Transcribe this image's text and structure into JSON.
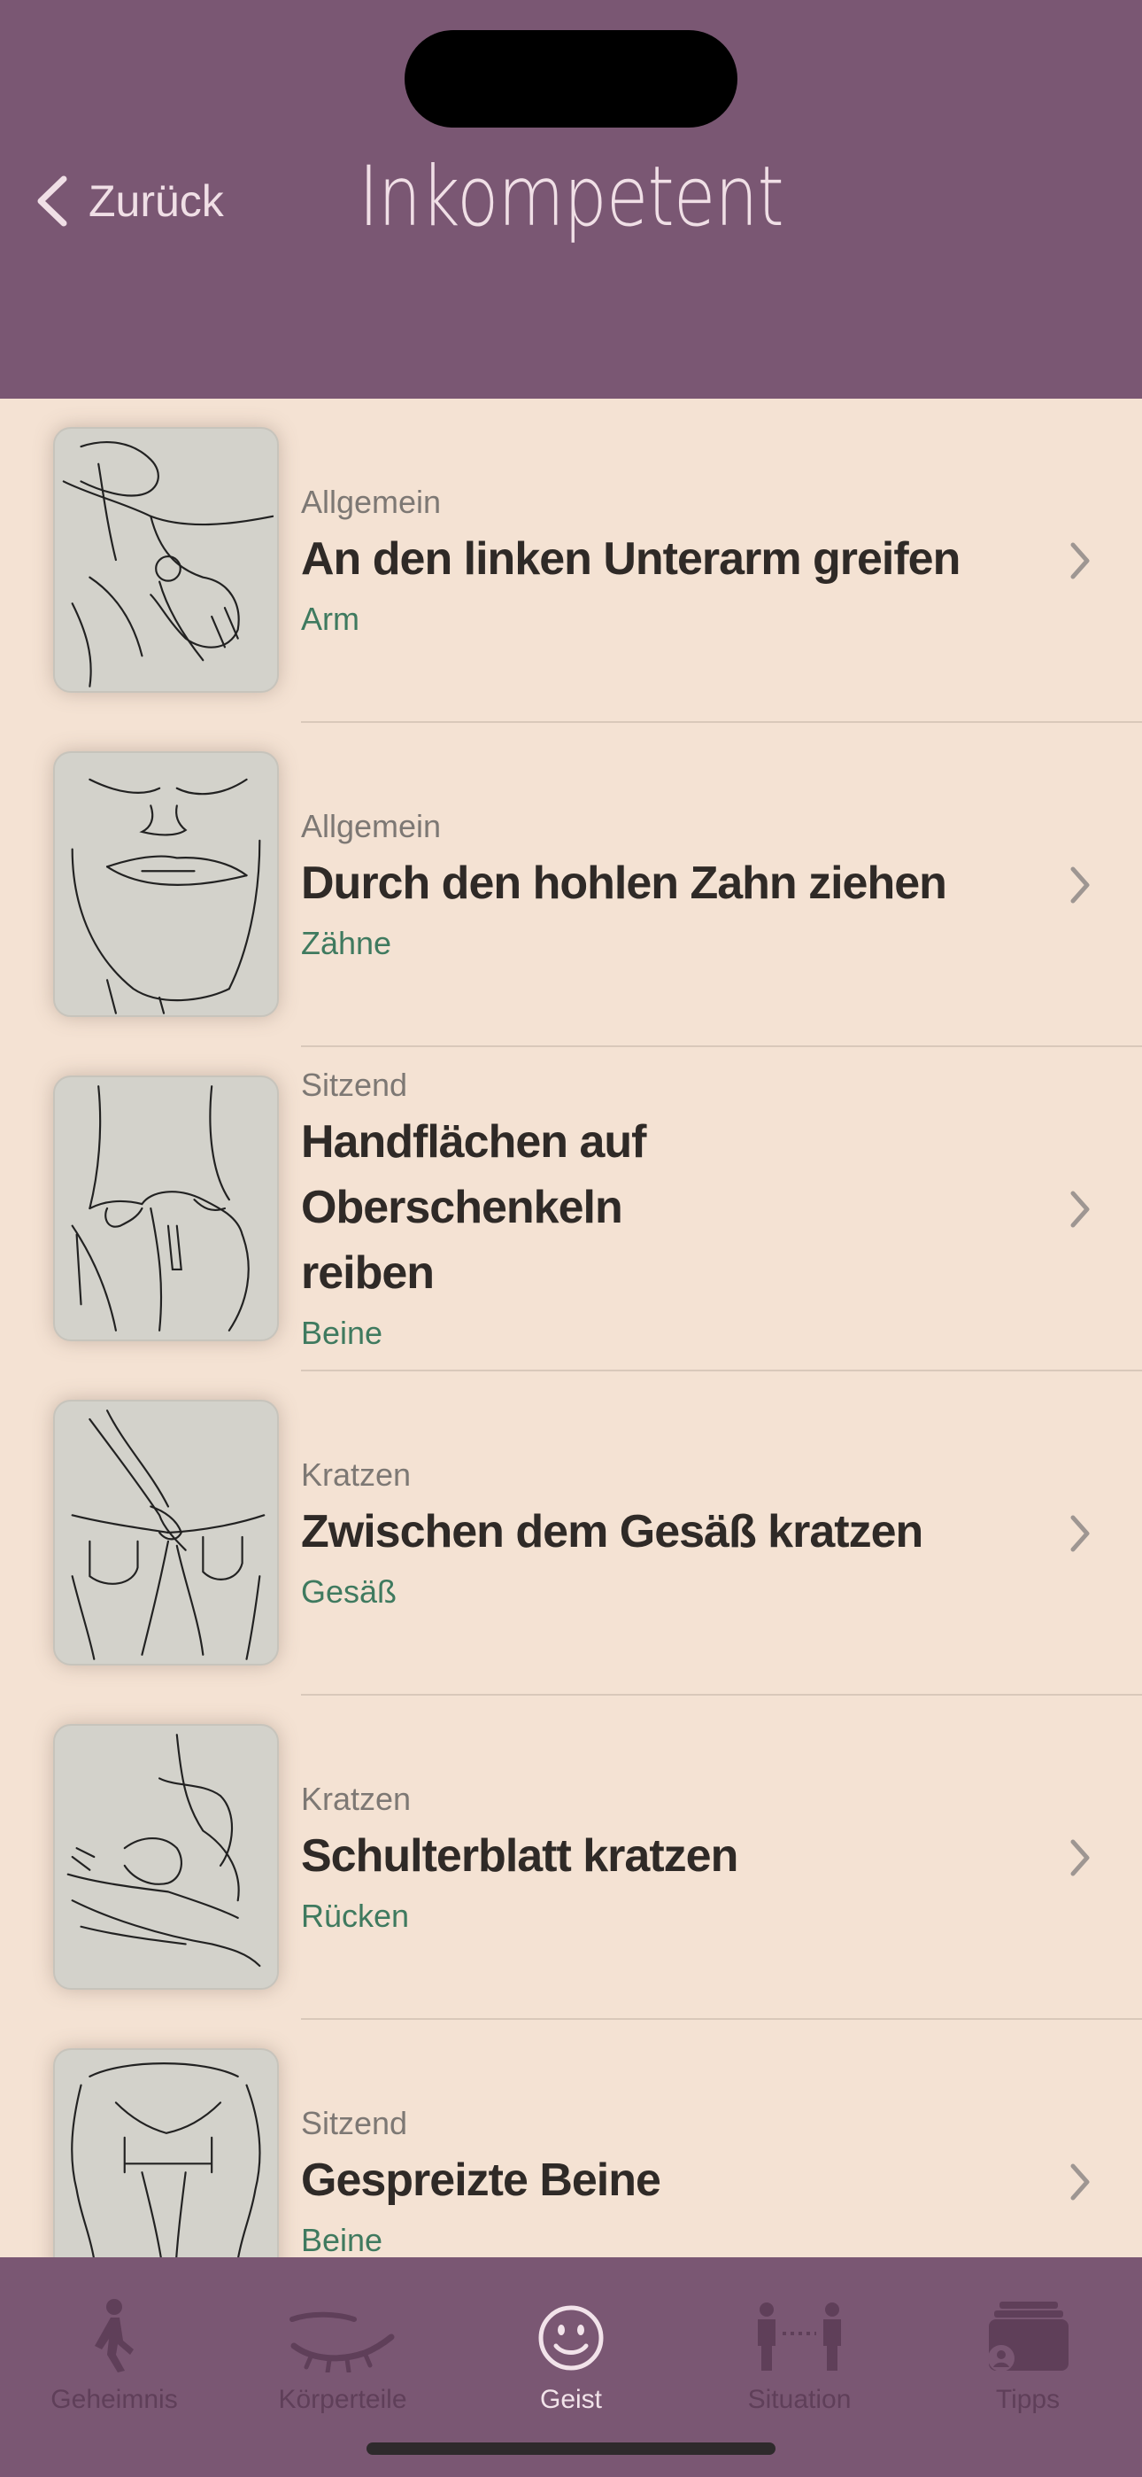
{
  "nav": {
    "back_label": "Zurück",
    "title": "Inkompetent"
  },
  "items": [
    {
      "category": "Allgemein",
      "title": "An den linken Unterarm greifen",
      "tag": "Arm",
      "icon": "arm-grab-sketch"
    },
    {
      "category": "Allgemein",
      "title": "Durch den hohlen Zahn ziehen",
      "tag": "Zähne",
      "icon": "mouth-sketch"
    },
    {
      "category": "Sitzend",
      "title": "Handflächen auf Oberschenkeln reiben",
      "tag": "Beine",
      "icon": "hands-on-thighs-sketch"
    },
    {
      "category": "Kratzen",
      "title": "Zwischen dem Gesäß kratzen",
      "tag": "Gesäß",
      "icon": "buttocks-scratch-sketch"
    },
    {
      "category": "Kratzen",
      "title": "Schulterblatt kratzen",
      "tag": "Rücken",
      "icon": "shoulder-scratch-sketch"
    },
    {
      "category": "Sitzend",
      "title": "Gespreizte Beine",
      "tag": "Beine",
      "icon": "spread-legs-sketch"
    }
  ],
  "tabs": [
    {
      "label": "Geheimnis",
      "icon": "walking-person-icon",
      "active": false
    },
    {
      "label": "Körperteile",
      "icon": "eye-closed-icon",
      "active": false
    },
    {
      "label": "Geist",
      "icon": "smiley-icon",
      "active": true
    },
    {
      "label": "Situation",
      "icon": "two-people-icon",
      "active": false
    },
    {
      "label": "Tipps",
      "icon": "cards-person-icon",
      "active": false
    }
  ],
  "colors": {
    "header": "#7a5773",
    "background": "#f4e2d3",
    "tag_green": "#3f7a5f",
    "tab_inactive": "#5f3f59",
    "tab_active": "#f2e3ea"
  }
}
